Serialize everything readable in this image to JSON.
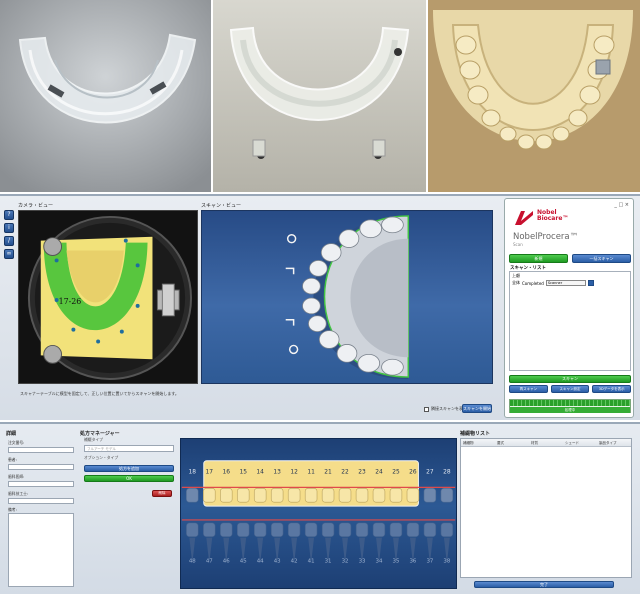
{
  "photos": [
    {
      "name": "clear-scan-template-top"
    },
    {
      "name": "clear-scan-template-front"
    },
    {
      "name": "plaster-model"
    }
  ],
  "toolbar": {
    "tools": [
      {
        "icon": "help-icon",
        "glyph": "?"
      },
      {
        "icon": "info-icon",
        "glyph": "i"
      },
      {
        "icon": "pen-icon",
        "glyph": "/"
      },
      {
        "icon": "link-icon",
        "glyph": "∞"
      }
    ]
  },
  "camera_view": {
    "label": "カメラ・ビュー",
    "tooth_range": "17-26"
  },
  "scan_view": {
    "label": "スキャン・ビュー"
  },
  "status_text": "スキャナーテーブルに模型を固定して、正しい位置に置いてからスキャンを開始します。",
  "options": {
    "adjacent_checkbox_label": "隣接スキャンを表示",
    "scan_button": "スキャンを開始"
  },
  "nobel_panel": {
    "window_controls": "_ □ ×",
    "logo_line1": "Nobel",
    "logo_line2": "Biocare™",
    "product": "NobelProcera™",
    "product_sub": "Scan",
    "tab_new": "新規",
    "tab_batch": "一括スキャン",
    "scan_list_title": "スキャン・リスト",
    "list_header": "上顧",
    "row_label": "全体",
    "row_status": "Completed",
    "row_select": "Scanner",
    "scan_button": "スキャン",
    "btn_rescan": "再スキャン",
    "btn_options": "スキャン設定",
    "btn_3d": "3Dデータを表示",
    "progress_label": "処理中",
    "progress_pct": 100
  },
  "details": {
    "title": "詳細",
    "fields": [
      {
        "label": "注文番号:"
      },
      {
        "label": "患者:"
      },
      {
        "label": "歯科医師:"
      },
      {
        "label": "歯科技工士:"
      }
    ],
    "notes_label": "備考:"
  },
  "prescription": {
    "title": "処方マネージャー",
    "type_label": "補綴タイプ",
    "type_value": "フルアーチ モデル",
    "option_label": "オプション・タイプ",
    "add_button": "処方を追加",
    "ok_button": "OK",
    "delete_button": "削除"
  },
  "tooth_chart": {
    "upper": [
      "18",
      "17",
      "16",
      "15",
      "14",
      "13",
      "12",
      "11",
      "21",
      "22",
      "23",
      "24",
      "25",
      "26",
      "27",
      "28"
    ],
    "lower": [
      "48",
      "47",
      "46",
      "45",
      "44",
      "43",
      "42",
      "41",
      "31",
      "32",
      "33",
      "34",
      "35",
      "36",
      "37",
      "38"
    ],
    "selected_range": [
      "17",
      "26"
    ]
  },
  "restorations": {
    "title": "補綴物リスト",
    "columns": [
      "補綴物",
      "要式",
      "材質",
      "シェード",
      "製品タイプ"
    ],
    "finish_button": "完了"
  },
  "colors": {
    "accent_blue": "#2b5ea6",
    "accent_green": "#1f9a22",
    "brand_red": "#c8102e",
    "scan_bg": "#3f6aa8"
  }
}
